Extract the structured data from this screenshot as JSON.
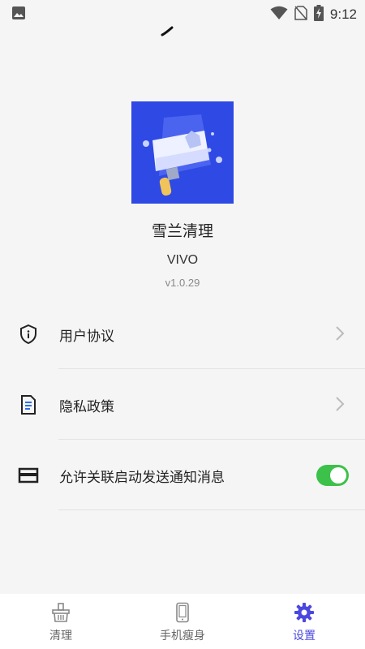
{
  "status_bar": {
    "time": "9:12",
    "icons": [
      "gallery-icon",
      "wifi-icon",
      "no-sim-icon",
      "battery-charging-icon"
    ]
  },
  "app": {
    "name": "雪兰清理",
    "subtitle": "VIVO",
    "version": "v1.0.29",
    "logo_icon": "broom-logo-icon",
    "brand_color": "#2f49e4"
  },
  "settings": {
    "items": [
      {
        "label": "用户协议",
        "icon": "shield-icon",
        "action": "chevron-right-icon"
      },
      {
        "label": "隐私政策",
        "icon": "document-icon",
        "action": "chevron-right-icon"
      },
      {
        "label": "允许关联启动发送通知消息",
        "icon": "wallet-icon",
        "toggle_on": true
      }
    ],
    "toggle_color": "#3cc14a"
  },
  "tabbar": {
    "tabs": [
      {
        "label": "清理",
        "icon": "basket-icon",
        "active": false
      },
      {
        "label": "手机瘦身",
        "icon": "phone-icon",
        "active": false
      },
      {
        "label": "设置",
        "icon": "gear-icon",
        "active": true
      }
    ],
    "active_color": "#4b47e0"
  }
}
